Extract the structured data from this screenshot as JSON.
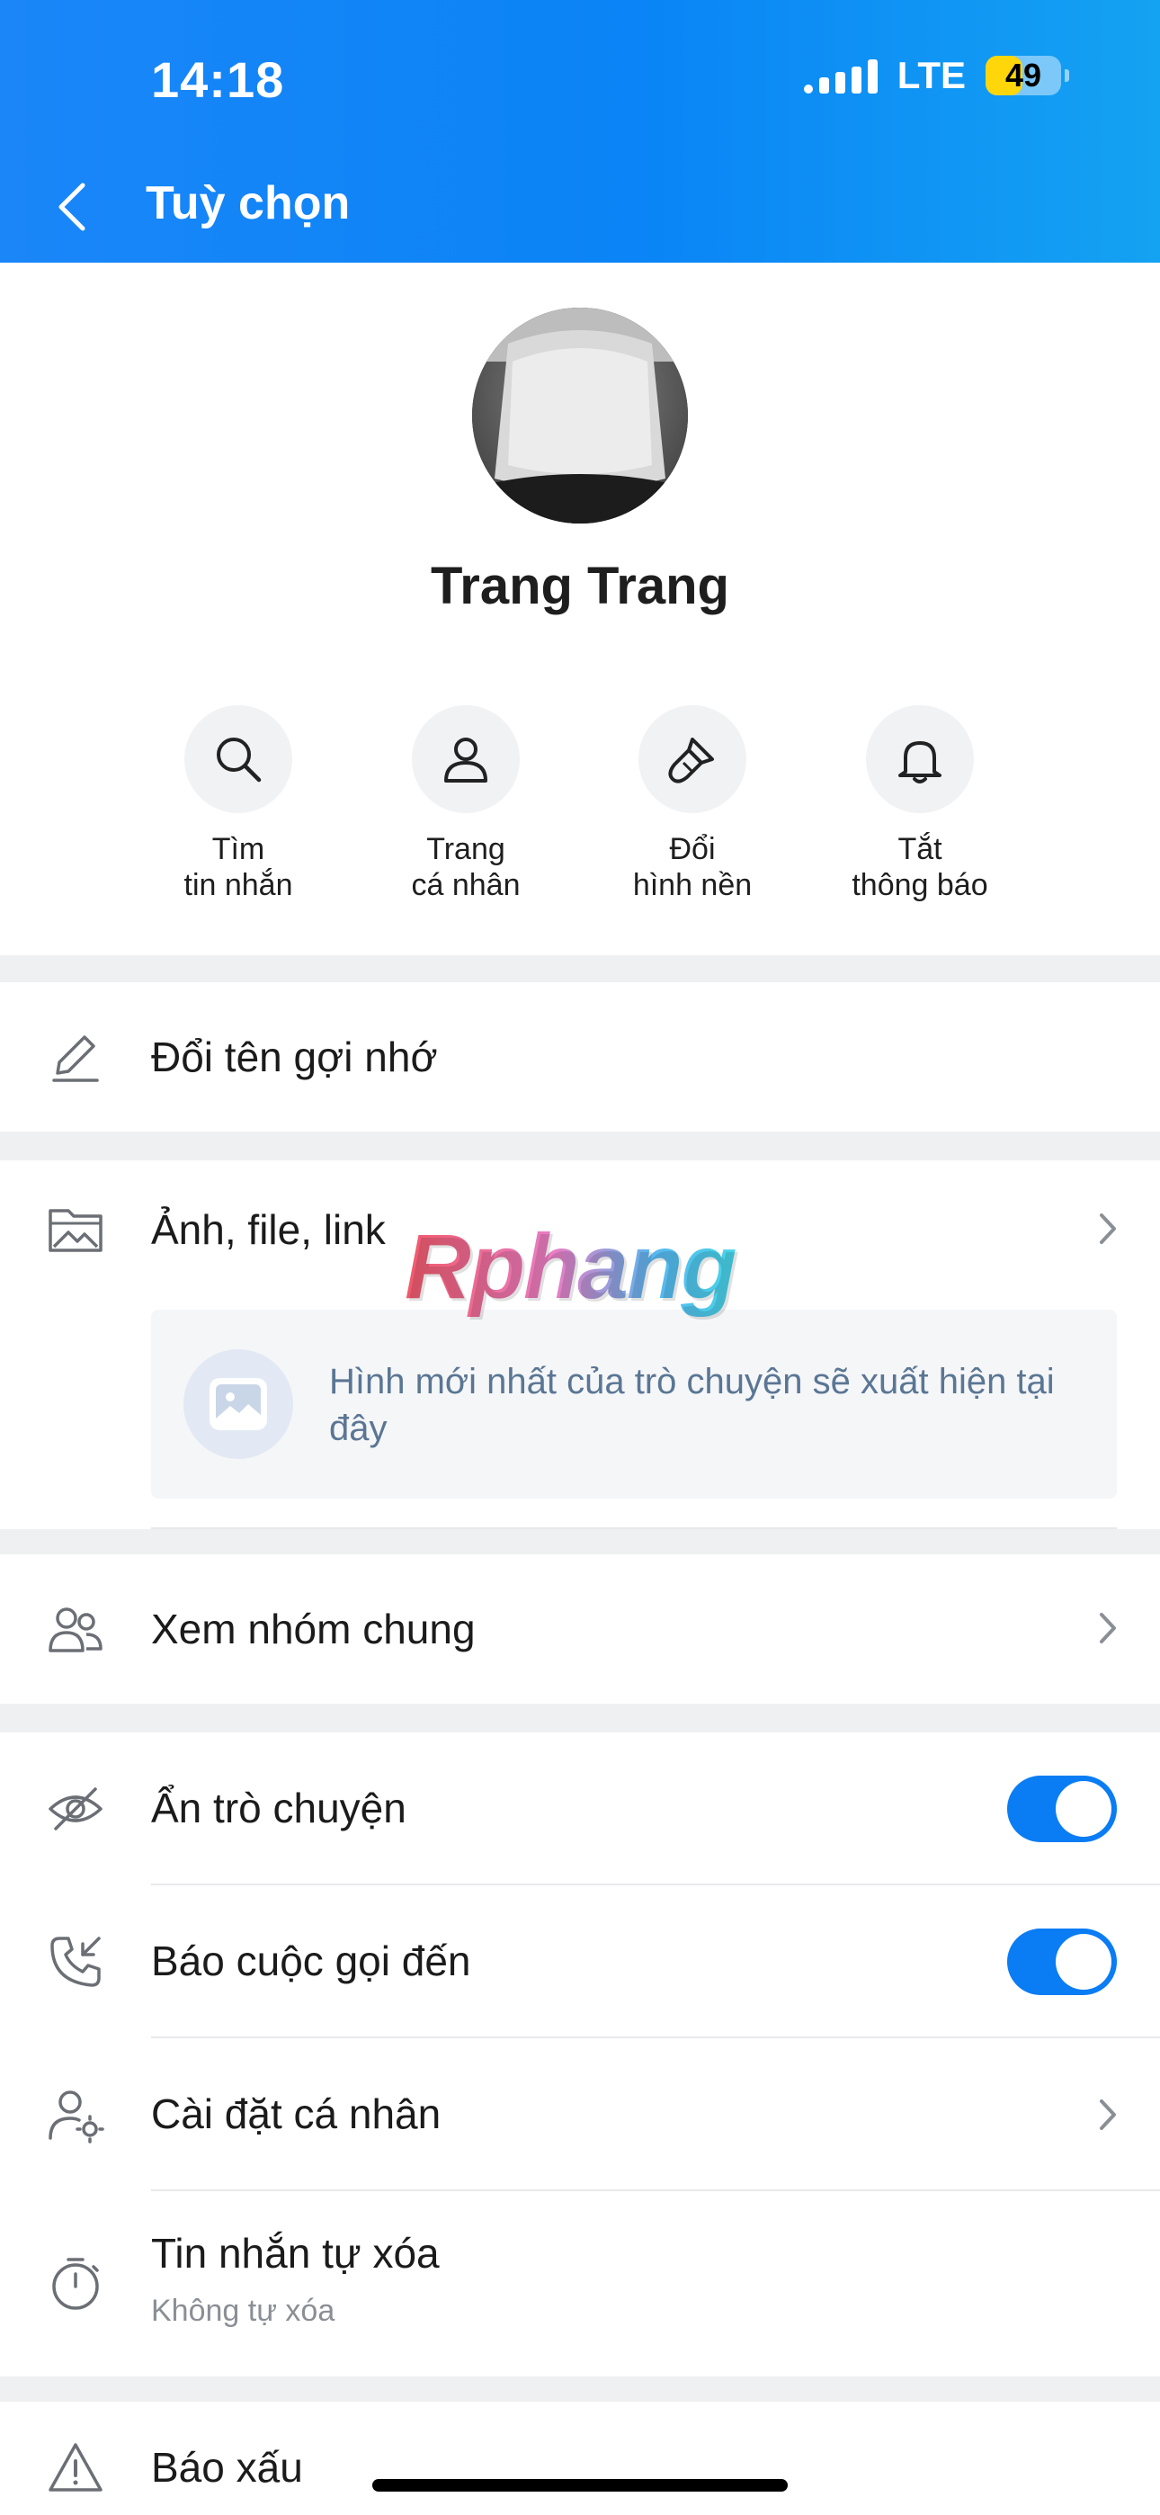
{
  "status_bar": {
    "time": "14:18",
    "network": "LTE",
    "battery": "49",
    "battery_level": 0.49
  },
  "header": {
    "title": "Tuỳ chọn"
  },
  "profile": {
    "name": "Trang Trang"
  },
  "actions": [
    {
      "label": "Tìm\ntin nhắn",
      "icon": "search-icon"
    },
    {
      "label": "Trang\ncá nhân",
      "icon": "person-icon"
    },
    {
      "label": "Đổi\nhình nền",
      "icon": "paintbrush-icon"
    },
    {
      "label": "Tắt\nthông báo",
      "icon": "bell-icon"
    }
  ],
  "menu": {
    "rename": "Đổi tên gợi nhớ",
    "media": {
      "label": "Ảnh, file, link",
      "placeholder": "Hình mới nhất của trò chuyện sẽ xuất hiện tại đây"
    },
    "groups": "Xem nhóm chung",
    "hide_chat": {
      "label": "Ẩn trò chuyện",
      "on": true
    },
    "incoming_call": {
      "label": "Báo cuộc gọi đến",
      "on": true
    },
    "personal_settings": "Cài đặt cá nhân",
    "auto_delete": {
      "label": "Tin nhắn tự xóa",
      "value": "Không tự xóa"
    },
    "report": "Báo xấu"
  },
  "watermark": "Rphang",
  "colors": {
    "header": "#0a84f6",
    "toggle_on": "#0a7cf4",
    "accent_text": "#5a7694"
  }
}
